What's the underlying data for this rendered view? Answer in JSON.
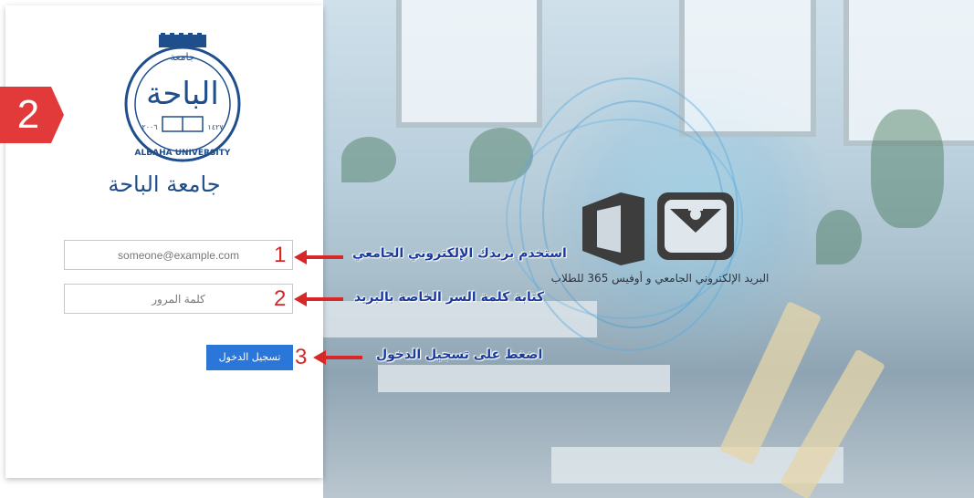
{
  "university": {
    "name_ar": "جامعة الباحة",
    "logo_text_top": "جامعة",
    "logo_text_main": "الباحة",
    "logo_text_en": "ALBAHA UNIVERSITY",
    "logo_year_left": "٢٠٠٦",
    "logo_year_right": "١٤٢٧"
  },
  "login": {
    "email_placeholder": "someone@example.com",
    "password_placeholder": "كلمة المرور",
    "signin_label": "تسجيل الدخول"
  },
  "step_badge": "2",
  "annotations": [
    {
      "num": "1",
      "text": "استخدم بريدك الإلكتروني الجامعي"
    },
    {
      "num": "2",
      "text": "كتابة كلمة السر الخاصة بالبريد"
    },
    {
      "num": "3",
      "text": "اضغط على تسجيل الدخول"
    }
  ],
  "office_caption": "البريد الإلكتروني الجامعي و أوفيس 365 للطلاب",
  "colors": {
    "accent_blue": "#2b76d9",
    "annotation_red": "#d62828",
    "annotation_text": "#1a3a9c",
    "uni_name": "#1f4e8c"
  }
}
